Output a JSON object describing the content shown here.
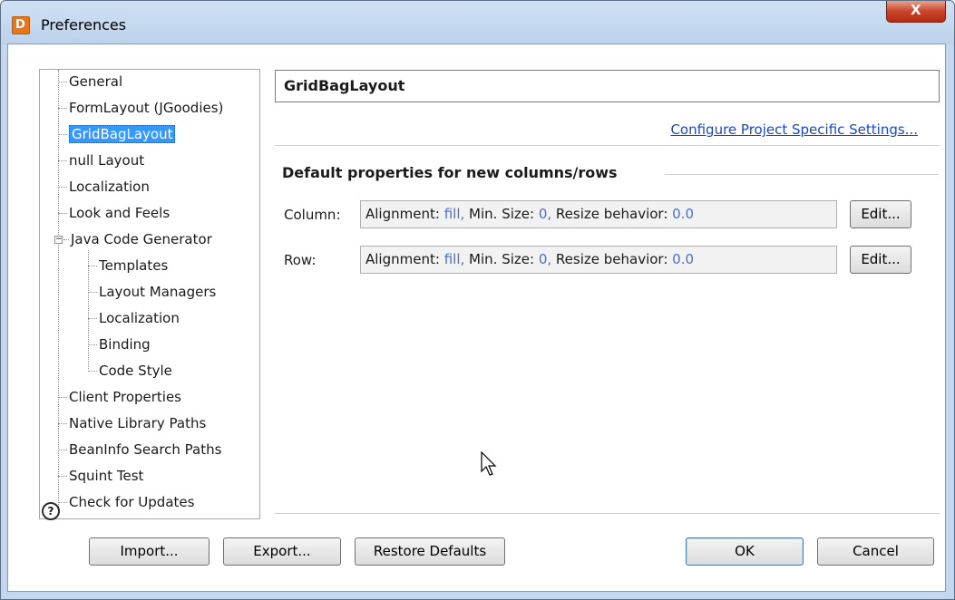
{
  "window": {
    "title": "Preferences",
    "close_label": "X",
    "app_icon_letter": "D"
  },
  "tree": {
    "items": [
      {
        "label": "General"
      },
      {
        "label": "FormLayout (JGoodies)"
      },
      {
        "label": "GridBagLayout",
        "selected": true
      },
      {
        "label": "null Layout"
      },
      {
        "label": "Localization"
      },
      {
        "label": "Look and Feels"
      },
      {
        "label": "Java Code Generator",
        "expanded": true
      },
      {
        "label": "Templates"
      },
      {
        "label": "Layout Managers"
      },
      {
        "label": "Localization"
      },
      {
        "label": "Binding"
      },
      {
        "label": "Code Style"
      },
      {
        "label": "Client Properties"
      },
      {
        "label": "Native Library Paths"
      },
      {
        "label": "BeanInfo Search Paths"
      },
      {
        "label": "Squint Test"
      },
      {
        "label": "Check for Updates"
      }
    ]
  },
  "page": {
    "heading": "GridBagLayout",
    "project_link": "Configure Project Specific Settings...",
    "section_title": "Default properties for new columns/rows",
    "column": {
      "label": "Column:",
      "alignment_label": "Alignment:",
      "alignment_value": "fill,",
      "min_label": "Min. Size:",
      "min_value": "0,",
      "resize_label": "Resize behavior:",
      "resize_value": "0.0",
      "edit_label": "Edit..."
    },
    "row": {
      "label": "Row:",
      "alignment_label": "Alignment:",
      "alignment_value": "fill,",
      "min_label": "Min. Size:",
      "min_value": "0,",
      "resize_label": "Resize behavior:",
      "resize_value": "0.0",
      "edit_label": "Edit..."
    }
  },
  "footer": {
    "help": "?",
    "import_label": "Import...",
    "export_label": "Export...",
    "restore_label": "Restore Defaults",
    "ok_label": "OK",
    "cancel_label": "Cancel"
  }
}
